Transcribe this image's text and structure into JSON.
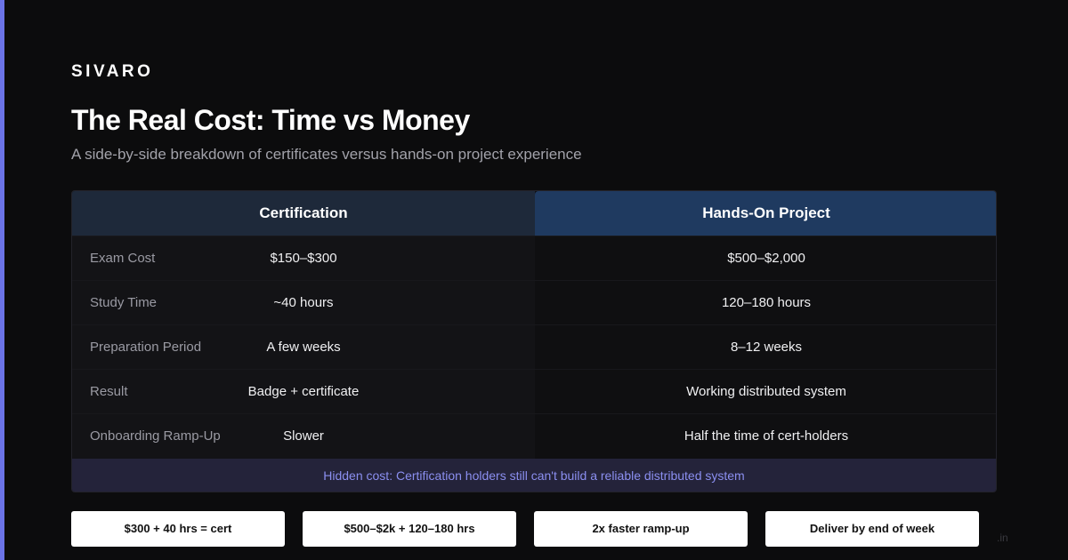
{
  "brand": "SIVARO",
  "title": "The Real Cost: Time vs Money",
  "subtitle": "A side-by-side breakdown of certificates versus hands-on project experience",
  "table": {
    "headers": {
      "certification": "Certification",
      "project": "Hands-On Project"
    },
    "rows": [
      {
        "label": "Exam Cost",
        "cert": "$150–$300",
        "project": "$500–$2,000"
      },
      {
        "label": "Study Time",
        "cert": "~40 hours",
        "project": "120–180 hours"
      },
      {
        "label": "Preparation Period",
        "cert": "A few weeks",
        "project": "8–12 weeks"
      },
      {
        "label": "Result",
        "cert": "Badge + certificate",
        "project": "Working distributed system"
      },
      {
        "label": "Onboarding Ramp-Up",
        "cert": "Slower",
        "project": "Half the time of cert-holders"
      }
    ],
    "footer_note": "Hidden cost: Certification holders still can't build a reliable distributed system"
  },
  "pills": [
    "$300 + 40 hrs = cert",
    "$500–$2k + 120–180 hrs",
    "2x faster ramp-up",
    "Deliver by end of week"
  ],
  "watermark": ".in",
  "colors": {
    "accent": "#6b73e6",
    "background": "#0c0c0d",
    "cert_header": "#1e293a",
    "project_header": "#1f3a60",
    "note_text": "#8b8ff0"
  }
}
